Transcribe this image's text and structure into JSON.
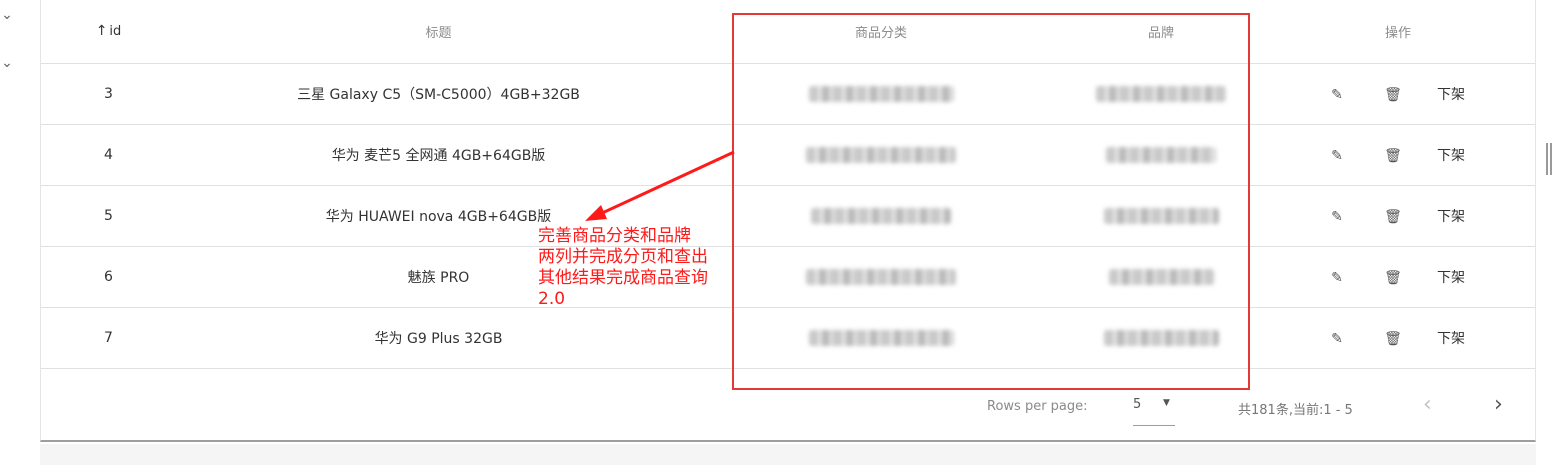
{
  "table": {
    "headers": {
      "sort_icon": "↑",
      "id": "id",
      "title": "标题",
      "category": "商品分类",
      "brand": "品牌",
      "actions": "操作"
    },
    "rows": [
      {
        "id": "3",
        "title": "三星 Galaxy C5（SM-C5000）4GB+32GB",
        "category": "",
        "brand": "",
        "off_shelf": "下架"
      },
      {
        "id": "4",
        "title": "华为 麦芒5 全网通 4GB+64GB版",
        "category": "",
        "brand": "",
        "off_shelf": "下架"
      },
      {
        "id": "5",
        "title": "华为 HUAWEI nova 4GB+64GB版",
        "category": "",
        "brand": "",
        "off_shelf": "下架"
      },
      {
        "id": "6",
        "title": "魅族 PRO",
        "category": "",
        "brand": "",
        "off_shelf": "下架"
      },
      {
        "id": "7",
        "title": "华为 G9 Plus 32GB",
        "category": "",
        "brand": "",
        "off_shelf": "下架"
      }
    ],
    "icons": {
      "edit": "pencil-icon",
      "delete": "trash-icon"
    }
  },
  "pagination": {
    "rows_per_page_label": "Rows per page:",
    "rows_per_page_value": "5",
    "range_text": "共181条,当前:1 - 5",
    "prev_icon": "chevron-left-icon",
    "next_icon": "chevron-right-icon"
  },
  "annotation": {
    "lines": [
      "完善商品分类和品牌",
      "两列并完成分页和查出",
      "其他结果完成商品查询",
      "2.0"
    ],
    "color": "#ff1a1a",
    "box_color": "#e53935"
  }
}
